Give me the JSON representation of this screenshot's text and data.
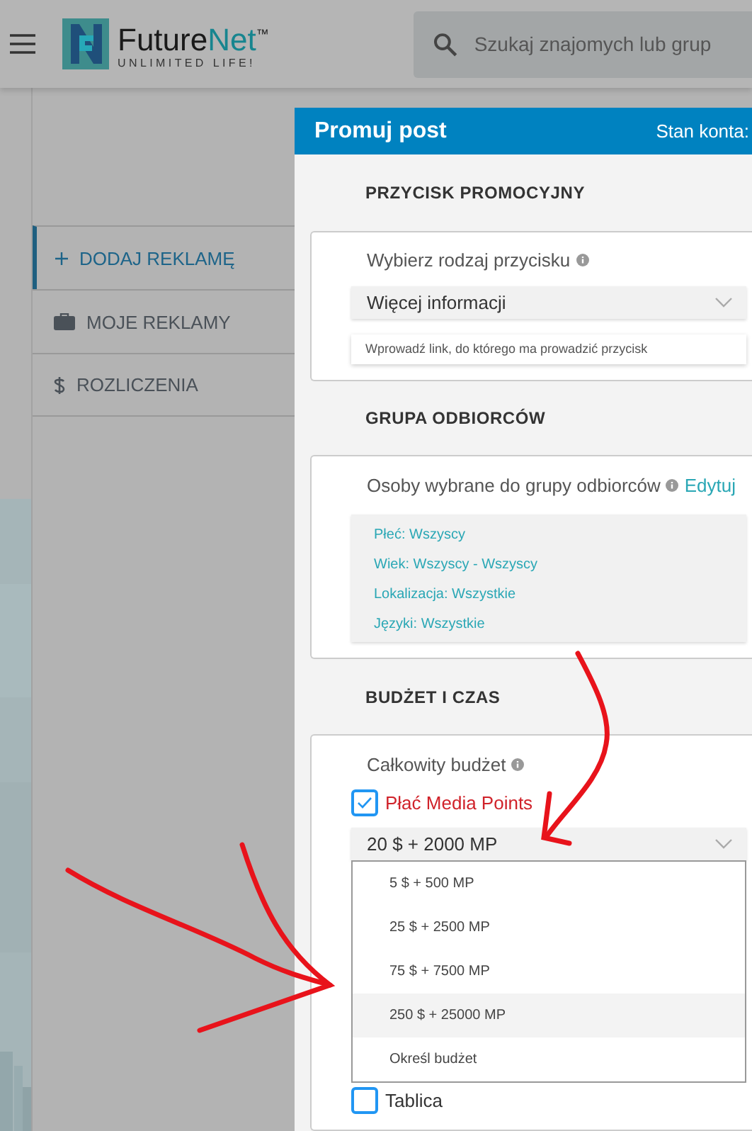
{
  "header": {
    "logo": {
      "name_dark": "Future",
      "name_accent": "Net",
      "trademark": "™",
      "tagline": "UNLIMITED LIFE!"
    },
    "search": {
      "placeholder": "Szukaj znajomych lub grup"
    }
  },
  "sidebar": {
    "items": [
      {
        "label": "DODAJ REKLAMĘ",
        "selected": true
      },
      {
        "label": "MOJE REKLAMY",
        "selected": false
      },
      {
        "label": "ROZLICZENIA",
        "selected": false
      }
    ]
  },
  "modal": {
    "title": "Promuj post",
    "account_label": "Stan konta:",
    "button_section": {
      "heading": "PRZYCISK PROMOCYJNY",
      "label": "Wybierz rodzaj przycisku",
      "select_value": "Więcej informacji",
      "link_placeholder": "Wprowadź link, do którego ma prowadzić przycisk"
    },
    "audience_section": {
      "heading": "GRUPA ODBIORCÓW",
      "label": "Osoby wybrane do grupy odbiorców",
      "edit_link": "Edytuj",
      "criteria": [
        "Płeć: Wszyscy",
        "Wiek: Wszyscy - Wszyscy",
        "Lokalizacja: Wszystkie",
        "Języki: Wszystkie"
      ]
    },
    "budget_section": {
      "heading": "BUDŻET I CZAS",
      "label": "Całkowity budżet",
      "media_points": {
        "label": "Płać Media Points",
        "checked": true
      },
      "budget_select": {
        "value": "20 $ + 2000 MP",
        "expanded": true,
        "options": [
          {
            "label": "5 $ + 500 MP",
            "selected": false
          },
          {
            "label": "25 $ + 2500 MP",
            "selected": false
          },
          {
            "label": "75 $ + 7500 MP",
            "selected": false
          },
          {
            "label": "250 $ + 25000 MP",
            "selected": true
          },
          {
            "label": "Określ budżet",
            "selected": false
          }
        ]
      },
      "wall": {
        "label": "Tablica",
        "checked": false
      }
    }
  }
}
